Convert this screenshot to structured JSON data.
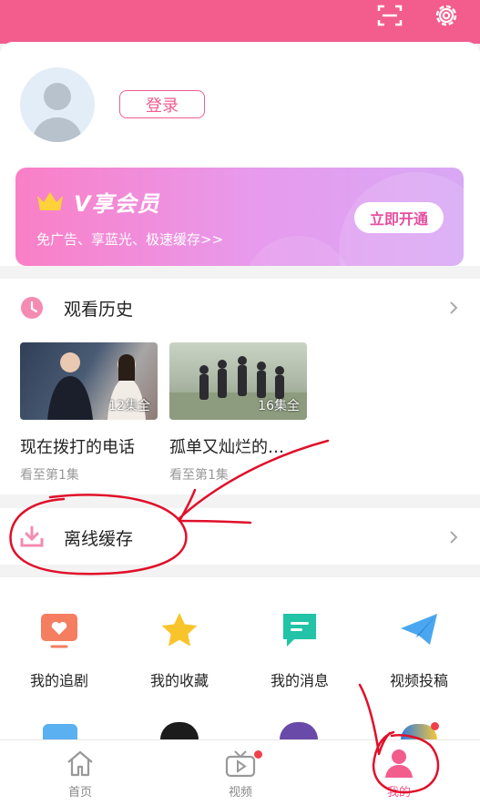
{
  "colors": {
    "accent": "#f25d8e",
    "ink": "#e0102a"
  },
  "header": {
    "scan_icon": "scan-icon",
    "settings_icon": "gear-icon"
  },
  "profile": {
    "login_label": "登录"
  },
  "vip": {
    "title": "V享会员",
    "subtitle": "免广告、享蓝光、极速缓存>>",
    "cta": "立即开通"
  },
  "history": {
    "title": "观看历史",
    "items": [
      {
        "title": "现在拨打的电话",
        "episodes": "12集全",
        "progress": "看至第1集"
      },
      {
        "title": "孤单又灿烂的…",
        "episodes": "16集全",
        "progress": "看至第1集"
      }
    ]
  },
  "offline": {
    "title": "离线缓存"
  },
  "grid": [
    {
      "label": "我的追剧",
      "icon": "tv-heart-icon"
    },
    {
      "label": "我的收藏",
      "icon": "star-icon"
    },
    {
      "label": "我的消息",
      "icon": "message-icon"
    },
    {
      "label": "视频投稿",
      "icon": "paper-plane-icon"
    }
  ],
  "tabs": [
    {
      "label": "首页",
      "icon": "home-icon"
    },
    {
      "label": "视频",
      "icon": "tv-play-icon"
    },
    {
      "label": "我的",
      "icon": "user-icon",
      "active": true
    }
  ]
}
